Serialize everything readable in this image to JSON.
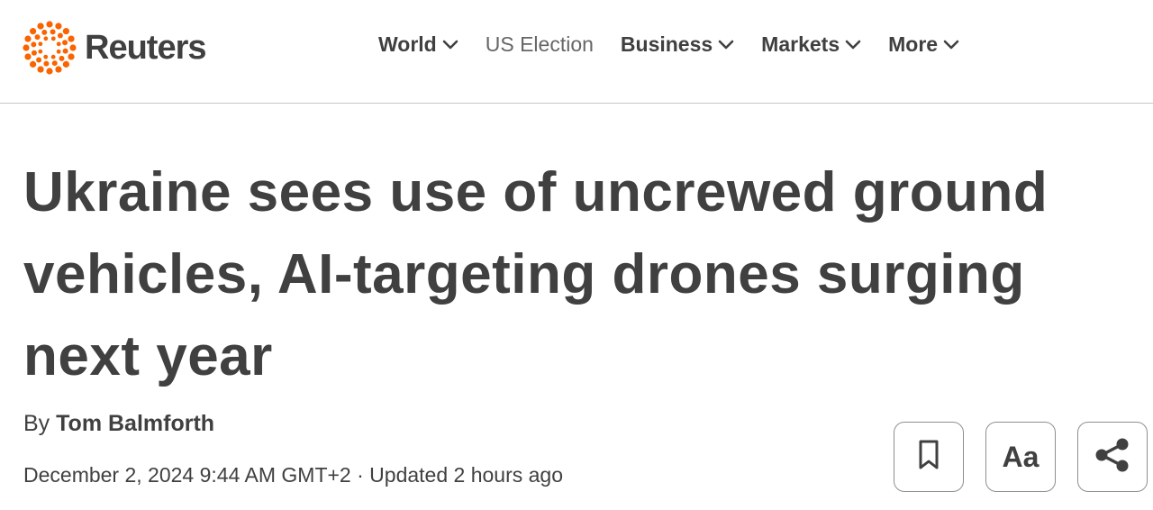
{
  "brand": {
    "name": "Reuters",
    "accent": "#fa6400",
    "text_color": "#404040"
  },
  "nav": {
    "items": [
      {
        "label": "World",
        "dropdown": true
      },
      {
        "label": "US Election",
        "dropdown": false
      },
      {
        "label": "Business",
        "dropdown": true
      },
      {
        "label": "Markets",
        "dropdown": true
      },
      {
        "label": "More",
        "dropdown": true
      }
    ]
  },
  "article": {
    "headline_lines": [
      "Ukraine sees use of uncrewed ground",
      "vehicles, AI-targeting drones surging",
      "next year"
    ],
    "byline_prefix": "By",
    "author": "Tom Balmforth",
    "date": "December 2, 2024 9:44 AM GMT+2",
    "separator": "·",
    "updated": "Updated 2 hours ago"
  },
  "tools": {
    "bookmark_icon": "bookmark-icon",
    "text_size_label": "Aa",
    "share_icon": "share-icon"
  }
}
